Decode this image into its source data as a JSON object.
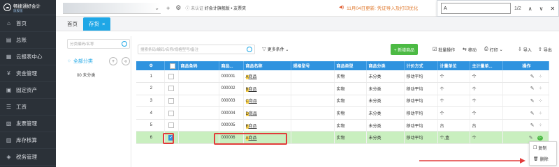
{
  "app": {
    "logo_title": "畅捷通好会计",
    "logo_sub": "旗舰版"
  },
  "sidebar": {
    "items": [
      {
        "label": "首页",
        "icon": "home-icon"
      },
      {
        "label": "总账",
        "icon": "ledger-icon"
      },
      {
        "label": "云报表中心",
        "icon": "report-icon"
      },
      {
        "label": "资金管理",
        "icon": "money-icon"
      },
      {
        "label": "固定资产",
        "icon": "asset-icon"
      },
      {
        "label": "工资",
        "icon": "salary-icon"
      },
      {
        "label": "发票管理",
        "icon": "invoice-icon"
      },
      {
        "label": "库存核算",
        "icon": "inventory-icon"
      },
      {
        "label": "税务管理",
        "icon": "tax-icon"
      }
    ]
  },
  "topbar": {
    "account_dropdown": "⌄",
    "cert_label": "未认证",
    "edition": "好会计旗舰版 • 友票夹",
    "notice": "11月04日更新: 凭证导入及打印优化"
  },
  "find": {
    "query": "A",
    "count": "1/2"
  },
  "tabs": [
    {
      "label": "首页",
      "active": false
    },
    {
      "label": "存货",
      "active": true,
      "close": "×"
    }
  ],
  "tree": {
    "search_placeholder": "分类编码/名称",
    "root_label": "全部分类",
    "child_label": "00 未分类"
  },
  "toolbar": {
    "search_placeholder": "搜索条码/编码/名称/规格型号/备注",
    "more_label": "更多条件",
    "add_label": "+ 新增商品",
    "batch_label": "批量操作",
    "move_label": "移动",
    "print_label": "打印",
    "import_label": "导入",
    "export_label": "导出"
  },
  "grid": {
    "columns": [
      "",
      "",
      "商品条码",
      "商品...",
      "商品名称",
      "规格型号",
      "商品类型",
      "商品分类",
      "计价方式",
      "计量单位",
      "主计量单...",
      "操作"
    ],
    "rows": [
      {
        "no": "1",
        "checked": false,
        "code": "000001",
        "hl": "A",
        "name": "商品",
        "type": "实物",
        "cat": "未分类",
        "method": "移动平均",
        "unit": "个",
        "main": "个"
      },
      {
        "no": "2",
        "checked": false,
        "code": "000002",
        "hl": "B",
        "name": "商品",
        "type": "实物",
        "cat": "未分类",
        "method": "移动平均",
        "unit": "个",
        "main": "个"
      },
      {
        "no": "3",
        "checked": false,
        "code": "000003",
        "hl": "C",
        "name": "商品",
        "type": "实物",
        "cat": "未分类",
        "method": "移动平均",
        "unit": "个",
        "main": "个"
      },
      {
        "no": "4",
        "checked": false,
        "code": "000004",
        "hl": "D",
        "name": "商品",
        "type": "实物",
        "cat": "未分类",
        "method": "移动平均",
        "unit": "个",
        "main": "个"
      },
      {
        "no": "5",
        "checked": false,
        "code": "000005",
        "hl": "E",
        "name": "商品",
        "type": "实物",
        "cat": "未分类",
        "method": "移动平均",
        "unit": "台",
        "main": "台"
      },
      {
        "no": "6",
        "checked": true,
        "code": "000006",
        "hl": "A",
        "name": "商品",
        "type": "实物",
        "cat": "未分类",
        "method": "移动平均",
        "unit": "个,盒",
        "main": "个"
      }
    ]
  },
  "context_menu": {
    "copy": "复制",
    "delete": "删除"
  },
  "colors": {
    "sidebar": "#2b3138",
    "header_blue": "#2f93df",
    "tab_active": "#1fa7e6",
    "add_green": "#4cba44",
    "row_selected": "#c9efbf",
    "annotation_red": "#e23b3b",
    "highlight": "#ffd54a"
  }
}
